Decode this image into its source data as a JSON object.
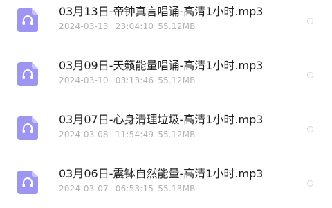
{
  "files": [
    {
      "title": "03月13日-帝钟真言唱诵-高清1小时.mp3",
      "date": "2024-03-13",
      "time": "23:04:10",
      "size": "55.12MB",
      "icon": "audio-file-icon",
      "selected": false
    },
    {
      "title": "03月09日-天籁能量唱诵-高清1小时.mp3",
      "date": "2024-03-10",
      "time": "03:13:46",
      "size": "55.12MB",
      "icon": "audio-file-icon",
      "selected": false
    },
    {
      "title": "03月07日-心身清理垃圾-高清1小时.mp3",
      "date": "2024-03-08",
      "time": "11:54:49",
      "size": "55.12MB",
      "icon": "audio-file-icon",
      "selected": false
    },
    {
      "title": "03月06日-震钵自然能量-高清1小时.mp3",
      "date": "2024-03-07",
      "time": "06:53:15",
      "size": "55.13MB",
      "icon": "audio-file-icon",
      "selected": false
    }
  ],
  "colors": {
    "icon_fill": "#9c95f2",
    "icon_fold": "#c8c4f9",
    "title": "#1f1f1f",
    "meta": "#b2b2b2"
  }
}
